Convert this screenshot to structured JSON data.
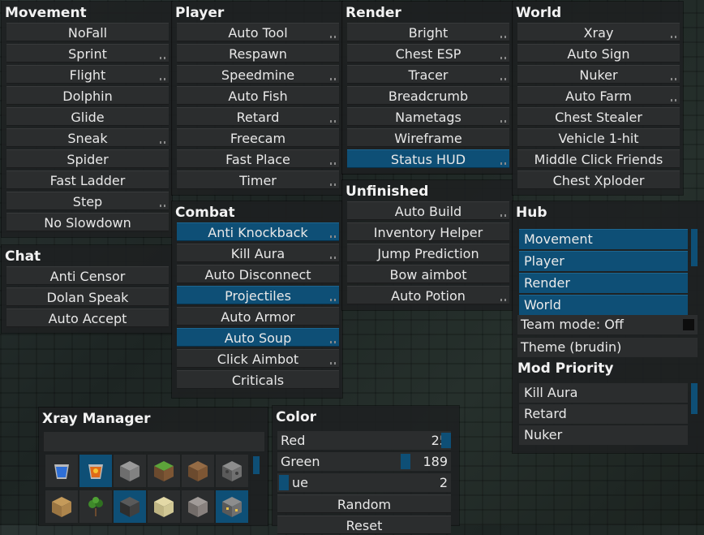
{
  "movement": {
    "title": "Movement",
    "items": [
      {
        "label": "NoFall"
      },
      {
        "label": "Sprint"
      },
      {
        "label": "Flight"
      },
      {
        "label": "Dolphin"
      },
      {
        "label": "Glide"
      },
      {
        "label": "Sneak"
      },
      {
        "label": "Spider"
      },
      {
        "label": "Fast Ladder"
      },
      {
        "label": "Step"
      },
      {
        "label": "No Slowdown"
      }
    ]
  },
  "player": {
    "title": "Player",
    "items": [
      {
        "label": "Auto Tool"
      },
      {
        "label": "Respawn"
      },
      {
        "label": "Speedmine"
      },
      {
        "label": "Auto Fish"
      },
      {
        "label": "Retard"
      },
      {
        "label": "Freecam"
      },
      {
        "label": "Fast Place"
      },
      {
        "label": "Timer"
      }
    ]
  },
  "render": {
    "title": "Render",
    "items": [
      {
        "label": "Bright"
      },
      {
        "label": "Chest ESP"
      },
      {
        "label": "Tracer"
      },
      {
        "label": "Breadcrumb"
      },
      {
        "label": "Nametags"
      },
      {
        "label": "Wireframe"
      },
      {
        "label": "Status HUD"
      }
    ]
  },
  "world": {
    "title": "World",
    "items": [
      {
        "label": "Xray"
      },
      {
        "label": "Auto Sign"
      },
      {
        "label": "Nuker"
      },
      {
        "label": "Auto Farm"
      },
      {
        "label": "Chest Stealer"
      },
      {
        "label": "Vehicle 1-hit"
      },
      {
        "label": "Middle Click Friends"
      },
      {
        "label": "Chest Xploder"
      }
    ]
  },
  "chat": {
    "title": "Chat",
    "items": [
      {
        "label": "Anti Censor"
      },
      {
        "label": "Dolan Speak"
      },
      {
        "label": "Auto Accept"
      }
    ]
  },
  "combat": {
    "title": "Combat",
    "items": [
      {
        "label": "Anti Knockback"
      },
      {
        "label": "Kill Aura"
      },
      {
        "label": "Auto Disconnect"
      },
      {
        "label": "Projectiles"
      },
      {
        "label": "Auto Armor"
      },
      {
        "label": "Auto Soup"
      },
      {
        "label": "Click Aimbot"
      },
      {
        "label": "Criticals"
      }
    ]
  },
  "unfinished": {
    "title": "Unfinished",
    "items": [
      {
        "label": "Auto Build"
      },
      {
        "label": "Inventory Helper"
      },
      {
        "label": "Jump Prediction"
      },
      {
        "label": "Bow aimbot"
      },
      {
        "label": "Auto Potion"
      }
    ]
  },
  "hub": {
    "title": "Hub",
    "panels": [
      "Movement",
      "Player",
      "Render",
      "World"
    ],
    "team_mode": "Team mode: Off",
    "theme": "Theme (brudin)",
    "mod_priority_title": "Mod Priority",
    "mod_priority": [
      "Kill Aura",
      "Retard",
      "Nuker"
    ]
  },
  "xray": {
    "title": "Xray Manager",
    "blocks_row1": [
      "water-bucket-icon",
      "lava-bucket-icon",
      "stone-block-icon",
      "grass-block-icon",
      "dirt-block-icon",
      "cobblestone-block-icon"
    ],
    "blocks_row2": [
      "oak-planks-icon",
      "sapling-icon",
      "bedrock-block-icon",
      "sand-block-icon",
      "gravel-block-icon",
      "gold-ore-block-icon"
    ]
  },
  "color": {
    "title": "Color",
    "red_label": "Red",
    "red_value": "25",
    "green_label": "Green",
    "green_value": "189",
    "blue_label": "ue",
    "blue_value": "2",
    "random_label": "Random",
    "reset_label": "Reset"
  },
  "colors": {
    "accent": "#0e4f76",
    "panel": "#1e2021",
    "button": "#2b2d2e",
    "text": "#e8e8e8"
  }
}
